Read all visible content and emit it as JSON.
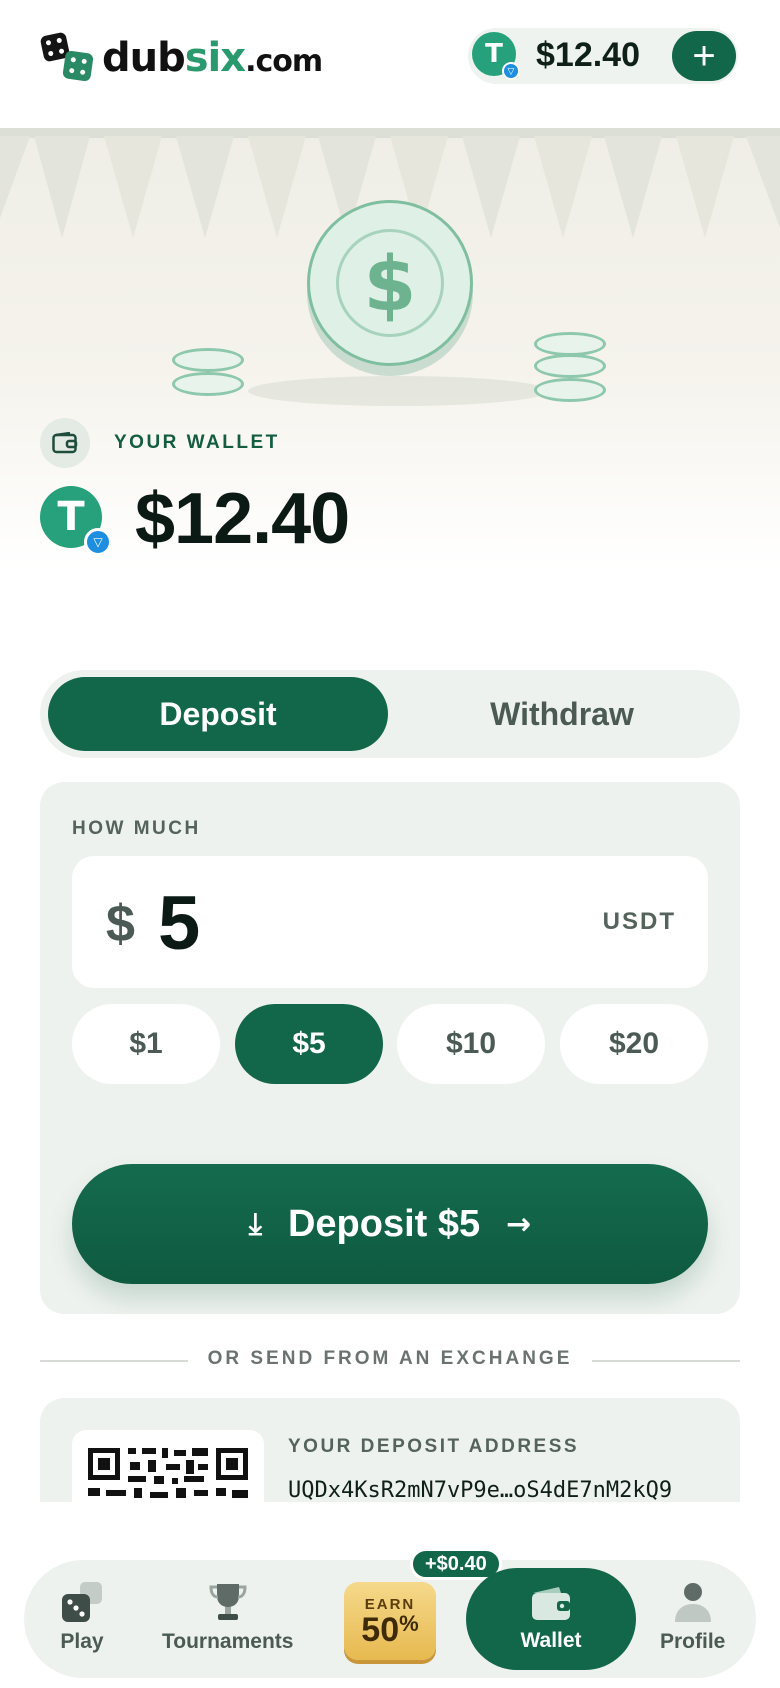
{
  "header": {
    "logo_main": "dub",
    "logo_accent": "six",
    "logo_suffix": ".com",
    "balance": "$12.40",
    "add_icon": "plus-icon"
  },
  "wallet": {
    "label": "YOUR WALLET",
    "balance": "$12.40",
    "token_icon": "tether-icon",
    "network_icon": "ton-icon"
  },
  "tabs": {
    "deposit": "Deposit",
    "withdraw": "Withdraw",
    "active": "Deposit"
  },
  "deposit_form": {
    "how_much_label": "HOW MUCH",
    "currency_symbol": "$",
    "amount": "5",
    "unit": "USDT",
    "quick_amounts": [
      "$1",
      "$5",
      "$10",
      "$20"
    ],
    "selected_quick": "$5",
    "submit_label": "Deposit $5"
  },
  "exchange": {
    "divider_text": "OR SEND FROM AN EXCHANGE",
    "address_label": "YOUR DEPOSIT ADDRESS",
    "address": "UQDx4KsR2mN7vP9e…oS4dE7nM2kQ9"
  },
  "bottom_nav": {
    "play": "Play",
    "tournaments": "Tournaments",
    "earn_top": "EARN",
    "earn_value": "50",
    "earn_suffix": "%",
    "earn_badge": "+$0.40",
    "wallet": "Wallet",
    "profile": "Profile"
  },
  "colors": {
    "brand": "#12664a",
    "tether": "#26a17b",
    "ton": "#1e8fe0",
    "earn_gold": "#e7b950"
  }
}
